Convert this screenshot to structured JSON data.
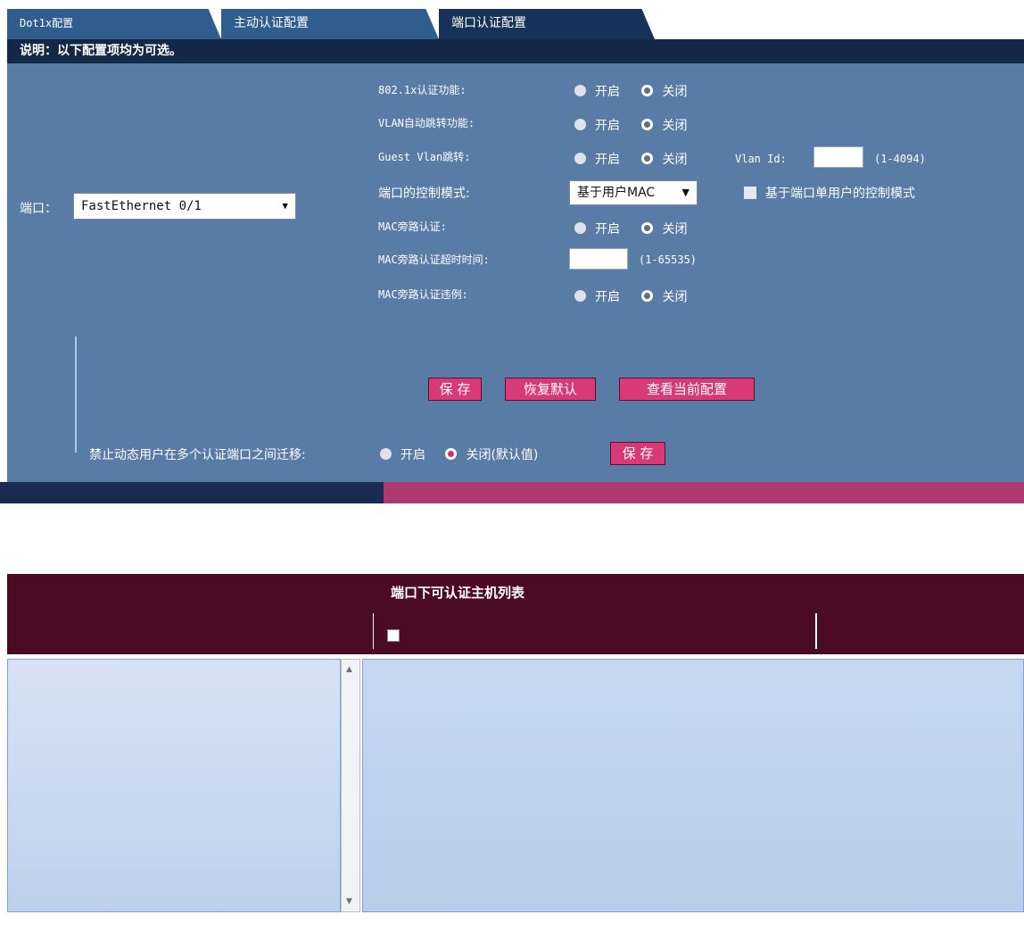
{
  "tabs": [
    {
      "label": "Dot1x配置"
    },
    {
      "label": "主动认证配置"
    },
    {
      "label": "端口认证配置"
    }
  ],
  "notice": "说明：以下配置项均为可选。",
  "port": {
    "label": "端口：",
    "selected": "FastEthernet 0/1"
  },
  "settings": {
    "dot1x_label": "802.1x认证功能:",
    "vlan_auto_label": "VLAN自动跳转功能:",
    "guest_vlan_label": "Guest Vlan跳转:",
    "vlan_id_label": "Vlan Id:",
    "vlan_id_range": "(1-4094)",
    "control_mode_label": "端口的控制模式:",
    "control_mode_value": "基于用户MAC",
    "single_user_label": "基于端口单用户的控制模式",
    "mac_bypass_label": "MAC旁路认证:",
    "mac_timeout_label": "MAC旁路认证超时时间:",
    "mac_timeout_range": "(1-65535)",
    "mac_violation_label": "MAC旁路认证违例:",
    "on_label": "开启",
    "off_label": "关闭"
  },
  "buttons": {
    "save": "保 存",
    "restore": "恢复默认",
    "view": "查看当前配置"
  },
  "migrate": {
    "label": "禁止动态用户在多个认证端口之间迁移:",
    "on": "开启",
    "off": "关闭(默认值)",
    "save": "保 存"
  },
  "host_list": {
    "title": "端口下可认证主机列表"
  },
  "colors": {
    "panel": "#587ca6",
    "notice_bg": "#142746",
    "button": "#d83a78",
    "list_header": "#4b0b22"
  }
}
